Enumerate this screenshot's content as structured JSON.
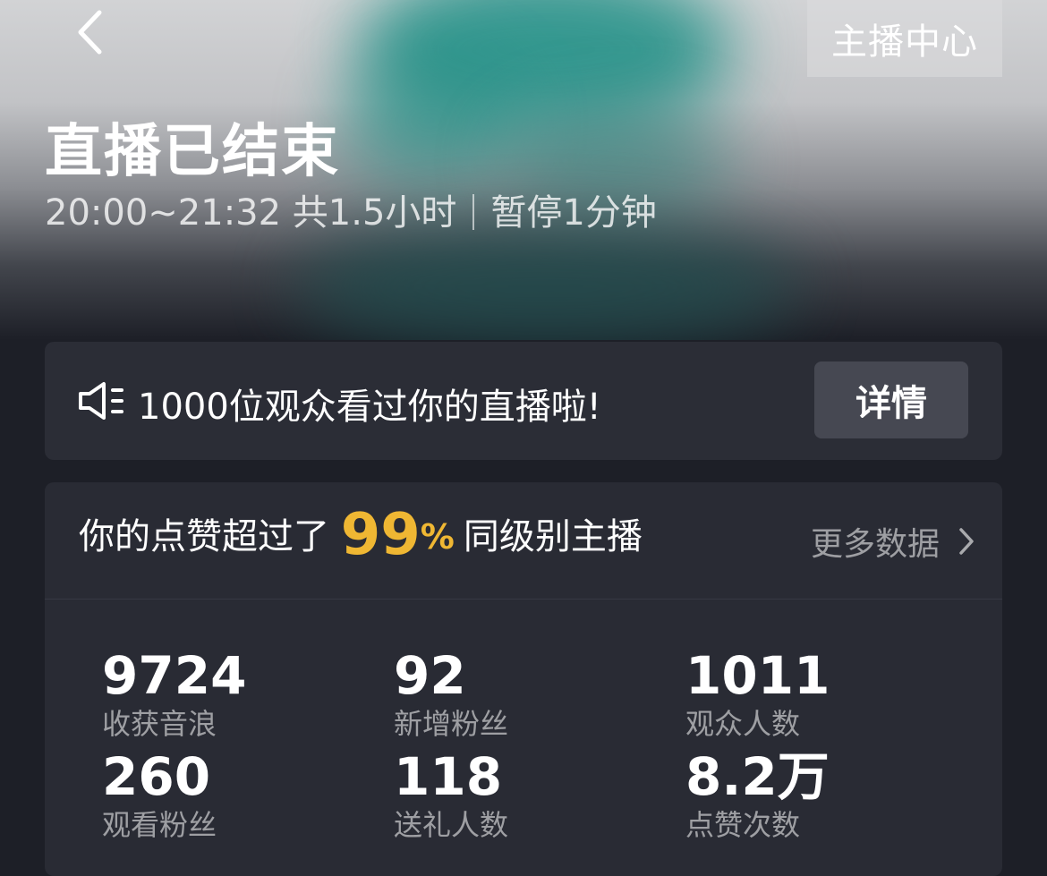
{
  "header": {
    "anchor_center_label": "主播中心",
    "title": "直播已结束",
    "time_range": "20:00~21:32",
    "duration": "共1.5小时",
    "pause": "暂停1分钟"
  },
  "notice": {
    "text": "1000位观众看过你的直播啦!",
    "detail_label": "详情"
  },
  "likes": {
    "prefix": "你的点赞超过了",
    "percent_value": "99",
    "percent_sign": "%",
    "suffix": "同级别主播",
    "more_label": "更多数据"
  },
  "stats": [
    {
      "value": "9724",
      "label": "收获音浪"
    },
    {
      "value": "92",
      "label": "新增粉丝"
    },
    {
      "value": "1011",
      "label": "观众人数"
    },
    {
      "value": "260",
      "label": "观看粉丝"
    },
    {
      "value": "118",
      "label": "送礼人数"
    },
    {
      "value": "8.2万",
      "label": "点赞次数"
    }
  ],
  "colors": {
    "accent": "#efb733",
    "background": "#1d1f27",
    "card": "#2b2d36"
  }
}
